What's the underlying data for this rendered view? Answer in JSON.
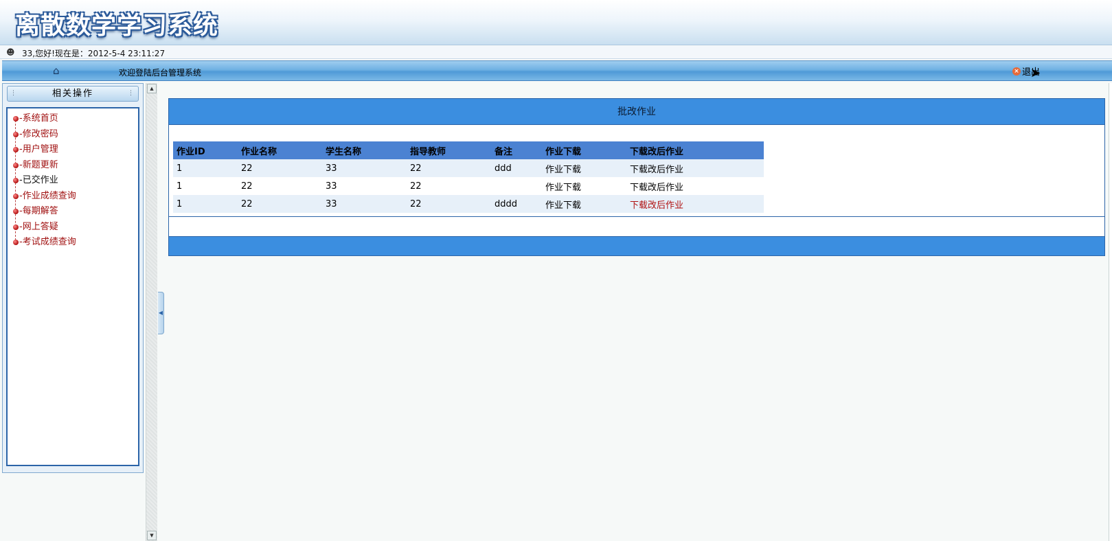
{
  "header": {
    "title": "离散数学学习系统",
    "greeting": "33,您好!现在是：2012-5-4 23:11:27",
    "user_icon": "user-icon"
  },
  "navbar": {
    "home_icon": "home-icon",
    "welcome": "欢迎登陆后台管理系统",
    "logout_label": "退出"
  },
  "sidebar": {
    "title": "相关操作",
    "items": [
      {
        "label": "-系统首页",
        "active": false
      },
      {
        "label": "-修改密码",
        "active": false
      },
      {
        "label": "-用户管理",
        "active": false
      },
      {
        "label": "-新题更新",
        "active": false
      },
      {
        "label": "-已交作业",
        "active": true
      },
      {
        "label": "-作业成绩查询",
        "active": false
      },
      {
        "label": "-每期解答",
        "active": false
      },
      {
        "label": "-网上答疑",
        "active": false
      },
      {
        "label": "-考试成绩查询",
        "active": false
      }
    ]
  },
  "main": {
    "panel_title": "批改作业",
    "table": {
      "headers": [
        "作业ID",
        "作业名称",
        "学生名称",
        "指导教师",
        "备注",
        "作业下载",
        "下载改后作业"
      ],
      "rows": [
        [
          "1",
          "22",
          "33",
          "22",
          "ddd",
          "作业下载",
          "下载改后作业"
        ],
        [
          "1",
          "22",
          "33",
          "22",
          "",
          "作业下载",
          "下载改后作业"
        ],
        [
          "1",
          "22",
          "33",
          "22",
          "dddd",
          "作业下载",
          "下载改后作业"
        ]
      ]
    }
  },
  "colors": {
    "panel_blue": "#3b8ee0",
    "header_row": "#4b82d2",
    "link_active": "#b01010"
  }
}
